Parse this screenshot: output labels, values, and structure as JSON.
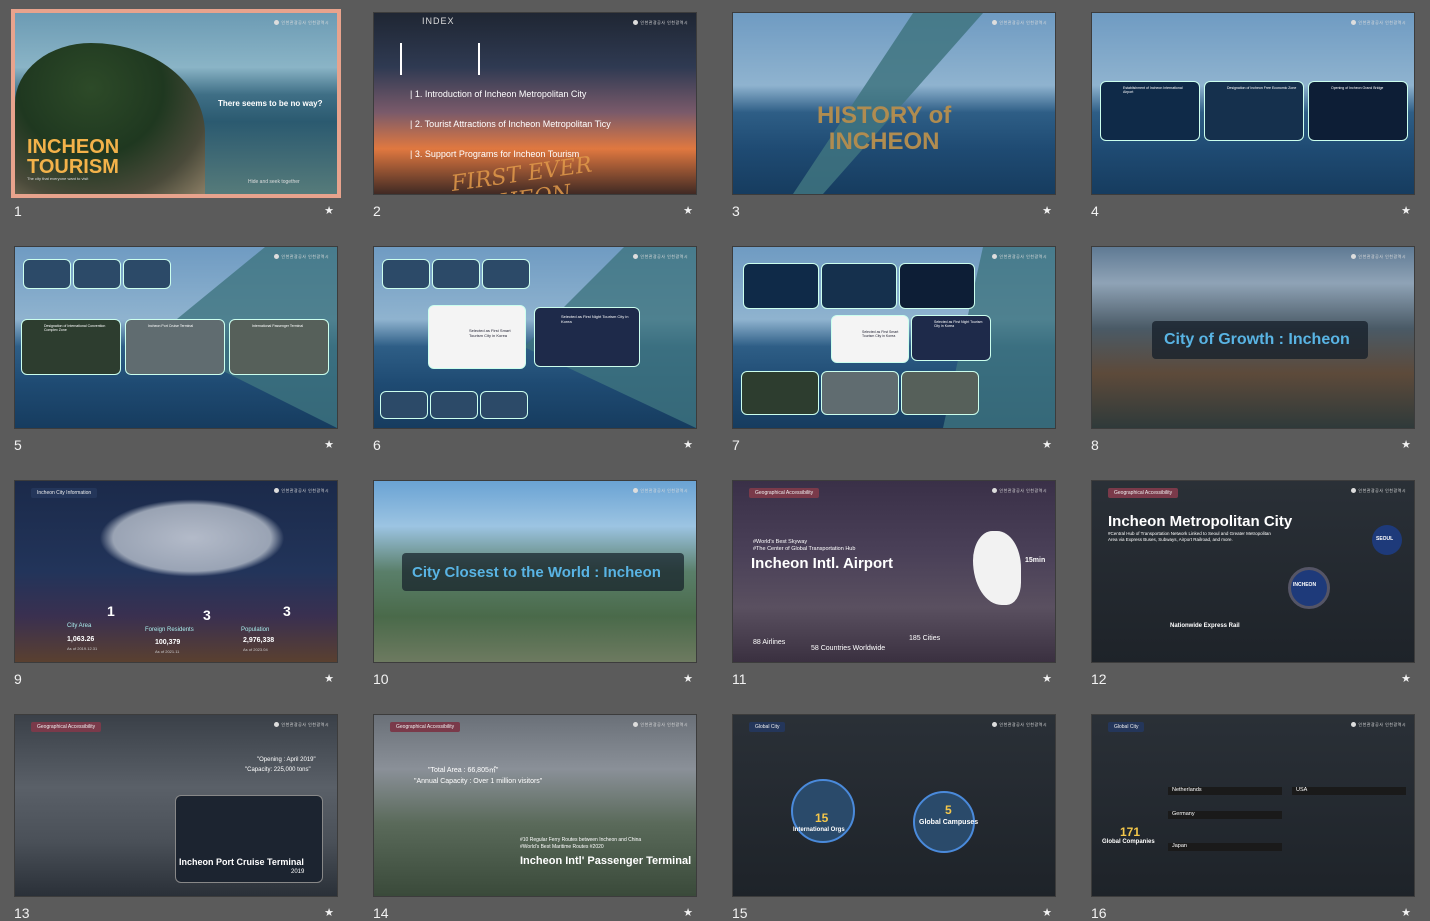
{
  "slides": [
    {
      "num": "1",
      "selected": true,
      "logo": "인천관광공사  인천광역시",
      "title": "INCHEON\nTOURISM",
      "subtitle": "The city that everyone want to visit",
      "quote": "There seems to be no way?",
      "caption": "Hide and seek together"
    },
    {
      "num": "2",
      "logo": "인천관광공사  인천광역시",
      "header": "INDEX",
      "items": [
        "| 1. Introduction of Incheon Metropolitan City",
        "| 2. Tourist Attractions of Incheon Metropolitan Ticy",
        "| 3. Support Programs for Incheon Tourism"
      ],
      "script": "FIRST EVER INCHEON"
    },
    {
      "num": "3",
      "logo": "인천관광공사  인천광역시",
      "title": "HISTORY of\nINCHEON"
    },
    {
      "num": "4",
      "logo": "인천관광공사  인천광역시",
      "cards": [
        "Establishment of Incheon International Airport",
        "Designation of Incheon Free Economic Zone",
        "Opening of Incheon Grand Bridge"
      ]
    },
    {
      "num": "5",
      "logo": "인천관광공사  인천광역시",
      "cards": [
        "Designation of International Convention Complex Zone",
        "Incheon Port Cruise Terminal",
        "International Passenger Terminal"
      ]
    },
    {
      "num": "6",
      "logo": "인천관광공사  인천광역시",
      "cards": [
        "Selected as First Smart Tourism City in Korea",
        "Selected as First Night Tourism City in Korea"
      ]
    },
    {
      "num": "7",
      "logo": "인천관광공사  인천광역시",
      "cards": [
        "Selected as First Smart Tourism City in Korea",
        "Selected as First Night Tourism City in Korea"
      ]
    },
    {
      "num": "8",
      "logo": "인천관광공사  인천광역시",
      "title": "City of Growth : Incheon"
    },
    {
      "num": "9",
      "logo": "인천관광공사  인천광역시",
      "tag": "Incheon City Information",
      "stats": [
        {
          "label": "City Area",
          "rank": "1",
          "value": "1,063.26",
          "note": "As of 2019.12.31"
        },
        {
          "label": "Foreign Residents",
          "rank": "3",
          "value": "100,379",
          "note": "As of 2021.11"
        },
        {
          "label": "Population",
          "rank": "3",
          "value": "2,976,338",
          "note": "As of 2023.04"
        }
      ]
    },
    {
      "num": "10",
      "logo": "인천관광공사  인천광역시",
      "title": "City Closest to the World : Incheon"
    },
    {
      "num": "11",
      "logo": "인천관광공사  인천광역시",
      "tag": "Geographical Accessibility",
      "kicker": "#World's Best Skyway\n#The Center of Global Transportation Hub",
      "title": "Incheon Intl. Airport",
      "airlines": "88 Airlines",
      "countries": "58 Countries Worldwide",
      "cities": "185 Cities",
      "mins": "15min"
    },
    {
      "num": "12",
      "logo": "인천관광공사  인천광역시",
      "tag": "Geographical Accessibility",
      "title": "Incheon Metropolitan City",
      "desc": "#Central Hub of Transportation Network Linked to Seoul and Greater Metropolitan Area via Express Buses, Subways, Airport Railroad, and more.",
      "seoul": "SEOUL",
      "incheon": "INCHEON",
      "rail": "Nationwide Express Rail"
    },
    {
      "num": "13",
      "logo": "인천관광공사  인천광역시",
      "tag": "Geographical Accessibility",
      "opening": "\"Opening : April 2019\"",
      "capacity": "\"Capacity: 225,000 tons\"",
      "title": "Incheon Port Cruise Terminal",
      "year": "2019"
    },
    {
      "num": "14",
      "logo": "인천관광공사  인천광역시",
      "tag": "Geographical Accessibility",
      "area": "\"Total Area : 66,805㎡\"",
      "annual": "\"Annual Capacity : Over 1 million visitors\"",
      "routes": "#10 Regular Ferry Routes between Incheon and China\n#World's Best Maritime Routes #2020",
      "title": "Incheon Intl' Passenger Terminal"
    },
    {
      "num": "15",
      "logo": "인천관광공사  인천광역시",
      "tag": "Global City",
      "orgs": "15",
      "orgs_label": "International Orgs",
      "campuses": "5",
      "campuses_label": "Global Campuses"
    },
    {
      "num": "16",
      "logo": "인천관광공사  인천광역시",
      "tag": "Global City",
      "companies": "171",
      "companies_label": "Global Companies",
      "countries": [
        "Netherlands",
        "USA",
        "Germany",
        "Japan"
      ]
    }
  ]
}
